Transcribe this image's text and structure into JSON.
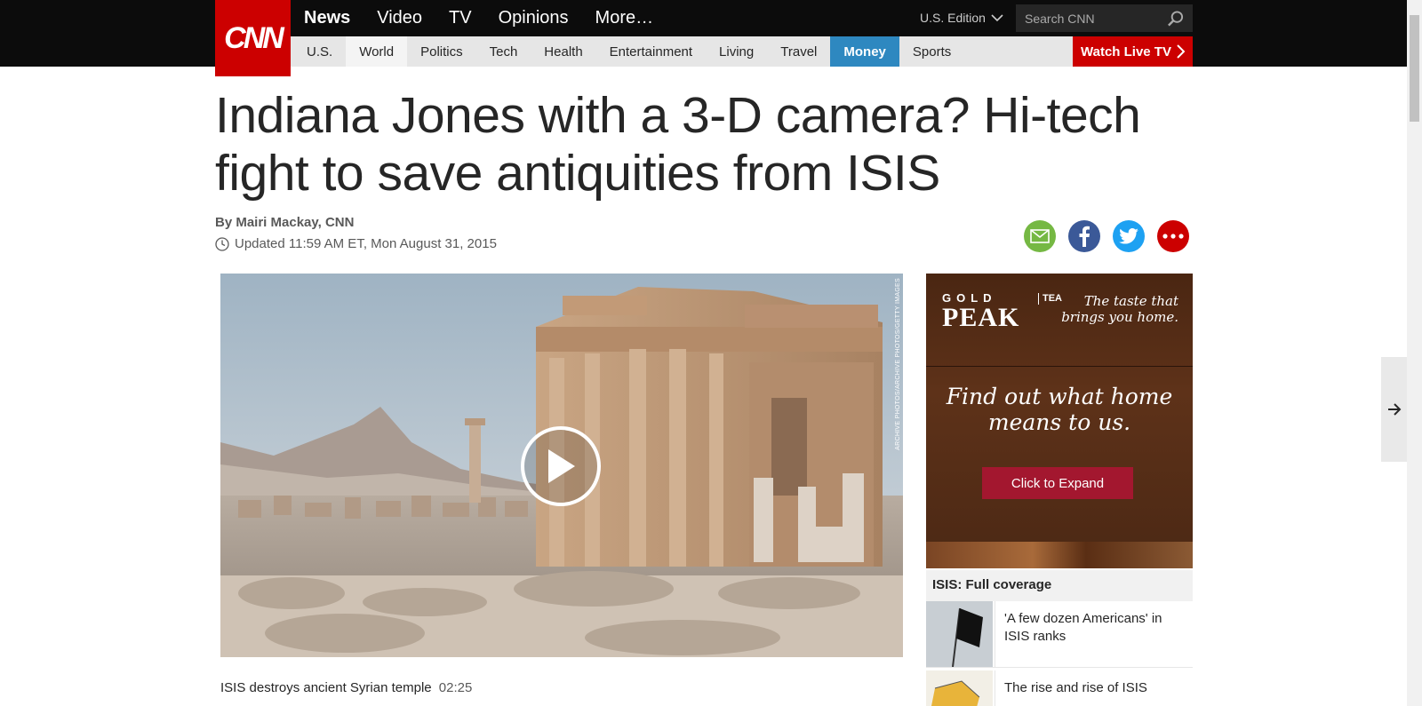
{
  "logo": {
    "text": "CNN"
  },
  "main_nav": [
    {
      "label": "News",
      "active": true
    },
    {
      "label": "Video"
    },
    {
      "label": "TV"
    },
    {
      "label": "Opinions"
    },
    {
      "label": "More…"
    }
  ],
  "edition": {
    "label": "U.S. Edition"
  },
  "search": {
    "placeholder": "Search CNN"
  },
  "sub_nav": [
    "U.S.",
    "World",
    "Politics",
    "Tech",
    "Health",
    "Entertainment",
    "Living",
    "Travel",
    "Money",
    "Sports"
  ],
  "watch_live": {
    "label": "Watch Live TV"
  },
  "article": {
    "headline": "Indiana Jones with a 3-D camera? Hi-tech fight to save antiquities from ISIS",
    "byline": "By Mairi Mackay, CNN",
    "updated": "Updated 11:59 AM ET, Mon August 31, 2015"
  },
  "video": {
    "credit": "ARCHIVE PHOTOS/ARCHIVE PHOTOS/GETTY IMAGES",
    "caption": "ISIS destroys ancient Syrian temple",
    "duration": "02:25"
  },
  "ad": {
    "brand_top": "GOLD",
    "brand_main": "PEAK",
    "brand_side": "TEA",
    "tagline": "The taste that brings you home.",
    "headline": "Find out what home means to us.",
    "button": "Click to Expand"
  },
  "sidebar": {
    "heading": "ISIS: Full coverage",
    "items": [
      {
        "title": "'A few dozen Americans' in ISIS ranks"
      },
      {
        "title": "The rise and rise of ISIS"
      }
    ]
  },
  "colors": {
    "cnn_red": "#cc0000",
    "money_blue": "#2e88c0",
    "ad_button": "#a3172f"
  }
}
